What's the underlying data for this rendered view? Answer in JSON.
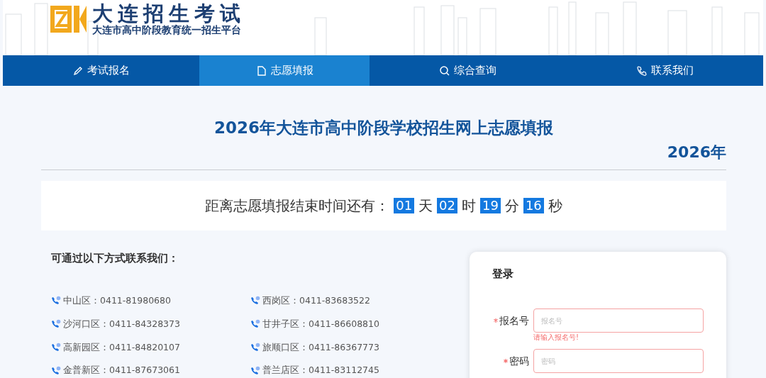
{
  "header": {
    "title": "大连招生考试",
    "subtitle": "大连市高中阶段教育统一招生平台"
  },
  "tabs": [
    {
      "label": "考试报名",
      "selected": false
    },
    {
      "label": "志愿填报",
      "selected": true
    },
    {
      "label": "综合查询",
      "selected": false
    },
    {
      "label": "联系我们",
      "selected": false
    }
  ],
  "page_title": "2026年大连市高中阶段学校招生网上志愿填报",
  "year": "2026年",
  "countdown": {
    "label": "距离志愿填报结束时间还有：",
    "segments": [
      {
        "value": "01",
        "unit": "天"
      },
      {
        "value": "02",
        "unit": "时"
      },
      {
        "value": "19",
        "unit": "分"
      },
      {
        "value": "16",
        "unit": "秒"
      }
    ]
  },
  "contacts": {
    "heading": "可通过以下方式联系我们：",
    "items": [
      {
        "text": "中山区：0411-81980680"
      },
      {
        "text": "西岗区：0411-83683522"
      },
      {
        "text": "沙河口区：0411-84328373"
      },
      {
        "text": "甘井子区：0411-86608810"
      },
      {
        "text": "高新园区：0411-84820107"
      },
      {
        "text": "旅顺口区：0411-86367773"
      },
      {
        "text": "金普新区：0411-87673061"
      },
      {
        "text": "普兰店区：0411-83112745"
      }
    ]
  },
  "login": {
    "title": "登录",
    "fields": [
      {
        "label": "报名号",
        "required": true,
        "placeholder": "报名号",
        "invalid": true,
        "error": "请输入报名号!"
      },
      {
        "label": "密码",
        "required": true,
        "placeholder": "密码",
        "invalid": true
      }
    ]
  }
}
